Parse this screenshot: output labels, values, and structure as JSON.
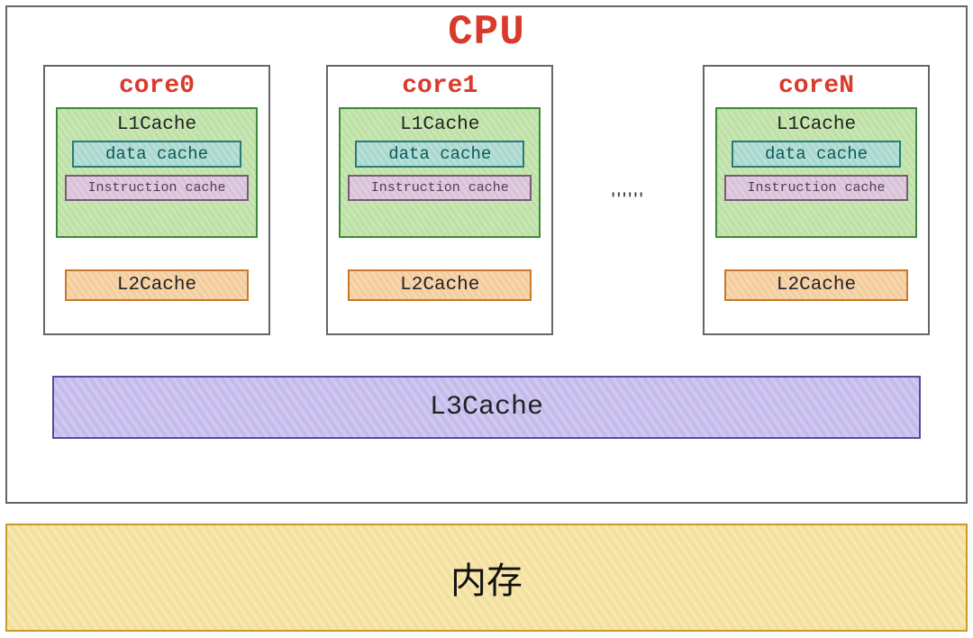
{
  "cpu": {
    "title": "CPU",
    "cores": [
      {
        "label": "core0",
        "l1": "L1Cache",
        "data": "data cache",
        "inst": "Instruction cache",
        "l2": "L2Cache"
      },
      {
        "label": "core1",
        "l1": "L1Cache",
        "data": "data cache",
        "inst": "Instruction cache",
        "l2": "L2Cache"
      },
      {
        "label": "coreN",
        "l1": "L1Cache",
        "data": "data cache",
        "inst": "Instruction cache",
        "l2": "L2Cache"
      }
    ],
    "ellipsis": "''''''",
    "l3": "L3Cache"
  },
  "memory": {
    "label": "内存"
  }
}
